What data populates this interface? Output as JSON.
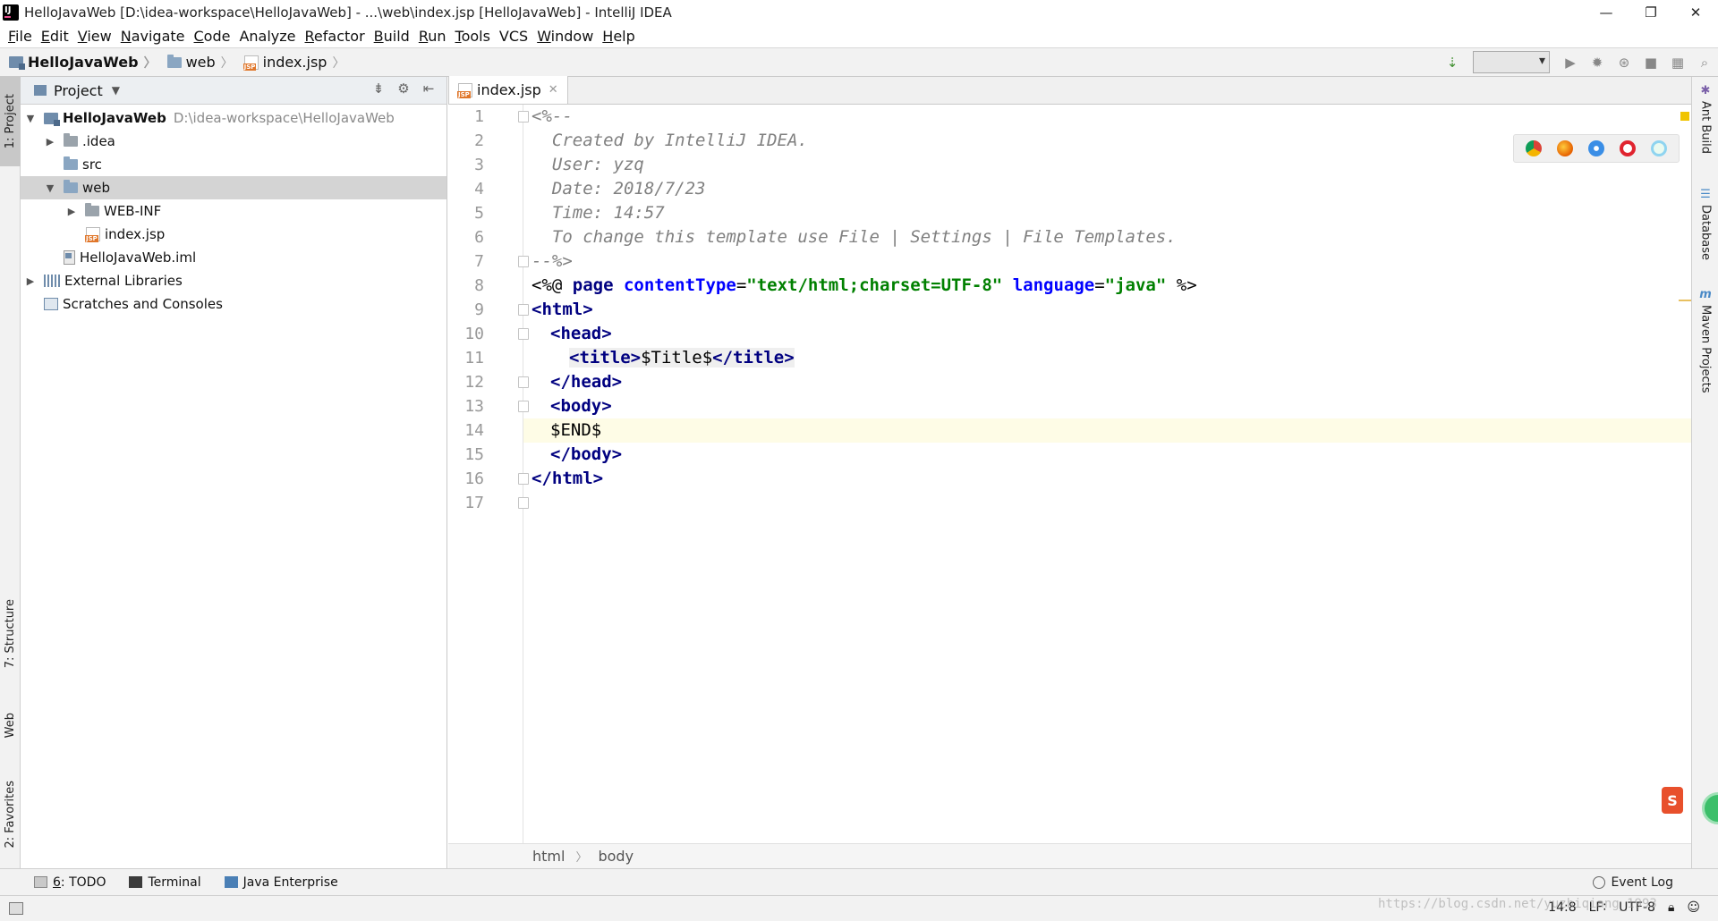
{
  "window": {
    "title": "HelloJavaWeb [D:\\idea-workspace\\HelloJavaWeb] - ...\\web\\index.jsp [HelloJavaWeb] - IntelliJ IDEA",
    "minimize": "—",
    "maximize": "❐",
    "close": "✕"
  },
  "menu": [
    {
      "mnemonic": "F",
      "rest": "ile"
    },
    {
      "mnemonic": "E",
      "rest": "dit"
    },
    {
      "mnemonic": "V",
      "rest": "iew"
    },
    {
      "mnemonic": "N",
      "rest": "avigate"
    },
    {
      "mnemonic": "C",
      "rest": "ode"
    },
    {
      "mnemonic": "",
      "rest": "Analyze"
    },
    {
      "mnemonic": "R",
      "rest": "efactor"
    },
    {
      "mnemonic": "B",
      "rest": "uild"
    },
    {
      "mnemonic": "R",
      "rest": "un"
    },
    {
      "mnemonic": "T",
      "rest": "ools"
    },
    {
      "mnemonic": "",
      "rest": "VCS"
    },
    {
      "mnemonic": "W",
      "rest": "indow"
    },
    {
      "mnemonic": "H",
      "rest": "elp"
    }
  ],
  "breadcrumb": [
    "HelloJavaWeb",
    "web",
    "index.jsp"
  ],
  "project_panel": {
    "title": "Project",
    "tree": {
      "root": {
        "name": "HelloJavaWeb",
        "path": "D:\\idea-workspace\\HelloJavaWeb"
      },
      "idea": ".idea",
      "src": "src",
      "web": "web",
      "webinf": "WEB-INF",
      "indexjsp": "index.jsp",
      "iml": "HelloJavaWeb.iml",
      "extlibs": "External Libraries",
      "scratches": "Scratches and Consoles"
    }
  },
  "left_tabs": {
    "project": "1: Project",
    "structure": "7: Structure",
    "web": "Web",
    "favorites": "2: Favorites"
  },
  "right_tabs": {
    "ant": "Ant Build",
    "database": "Database",
    "maven": "Maven Projects"
  },
  "editor": {
    "tab": "index.jsp",
    "line_numbers": [
      "1",
      "2",
      "3",
      "4",
      "5",
      "6",
      "7",
      "8",
      "9",
      "10",
      "11",
      "12",
      "13",
      "14",
      "15",
      "16",
      "17"
    ],
    "current_line": 14,
    "code": {
      "l1": "<%--",
      "l2": "  Created by IntelliJ IDEA.",
      "l3": "  User: yzq",
      "l4": "  Date: 2018/7/23",
      "l5": "  Time: 14:57",
      "l6": "  To change this template use File | Settings | File Templates.",
      "l7": "--%>",
      "l8": {
        "open": "<%@ ",
        "kw": "page ",
        "a1": "contentType",
        "eq1": "=",
        "v1": "\"text/html;charset=UTF-8\"",
        "sp": " ",
        "a2": "language",
        "eq2": "=",
        "v2": "\"java\"",
        "close": " %>"
      },
      "l9": "<html>",
      "l10": "<head>",
      "l11": {
        "open": "<title>",
        "text": "$Title$",
        "close": "</title>"
      },
      "l12": "</head>",
      "l13": "<body>",
      "l14": "$END$",
      "l15": "</body>",
      "l16": "</html>"
    },
    "breadcrumb": [
      "html",
      "body"
    ]
  },
  "bottom_tools": {
    "todo_num": "6",
    "todo_rest": ": TODO",
    "terminal": "Terminal",
    "java_ee": "Java Enterprise",
    "event_log": "Event Log"
  },
  "status": {
    "position": "14:8",
    "line_sep": "LF∶",
    "encoding": "UTF-8",
    "watermark": "https://blog.csdn.net/yuzhiqiang_1993"
  },
  "colors": {
    "tag": "#000080",
    "attr": "#0000ff",
    "string": "#008000",
    "comment": "#808080",
    "current_line": "#fefce6"
  }
}
